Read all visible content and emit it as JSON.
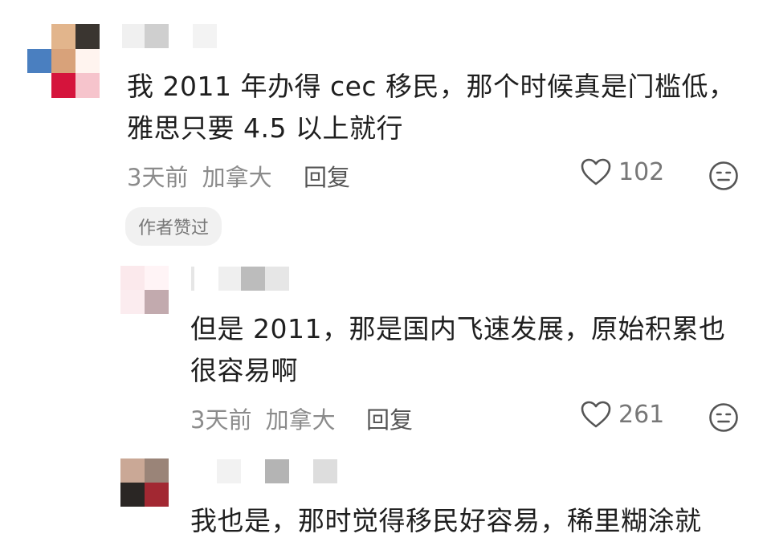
{
  "comments": [
    {
      "text_line1": "我 2011 年办得 cec 移民，那个时候真是门槛低，",
      "text_line2": "雅思只要 4.5 以上就行",
      "time": "3天前",
      "location": "加拿大",
      "reply_label": "回复",
      "likes": "102",
      "badge": "作者赞过"
    },
    {
      "text_line1": "但是 2011，那是国内飞速发展，原始积累也",
      "text_line2": "很容易啊",
      "time": "3天前",
      "location": "加拿大",
      "reply_label": "回复",
      "likes": "261"
    },
    {
      "text_line1": "我也是，那时觉得移民好容易，稀里糊涂就"
    }
  ],
  "icons": {
    "like": "heart-outline-icon",
    "dislike": "neutral-face-icon"
  }
}
